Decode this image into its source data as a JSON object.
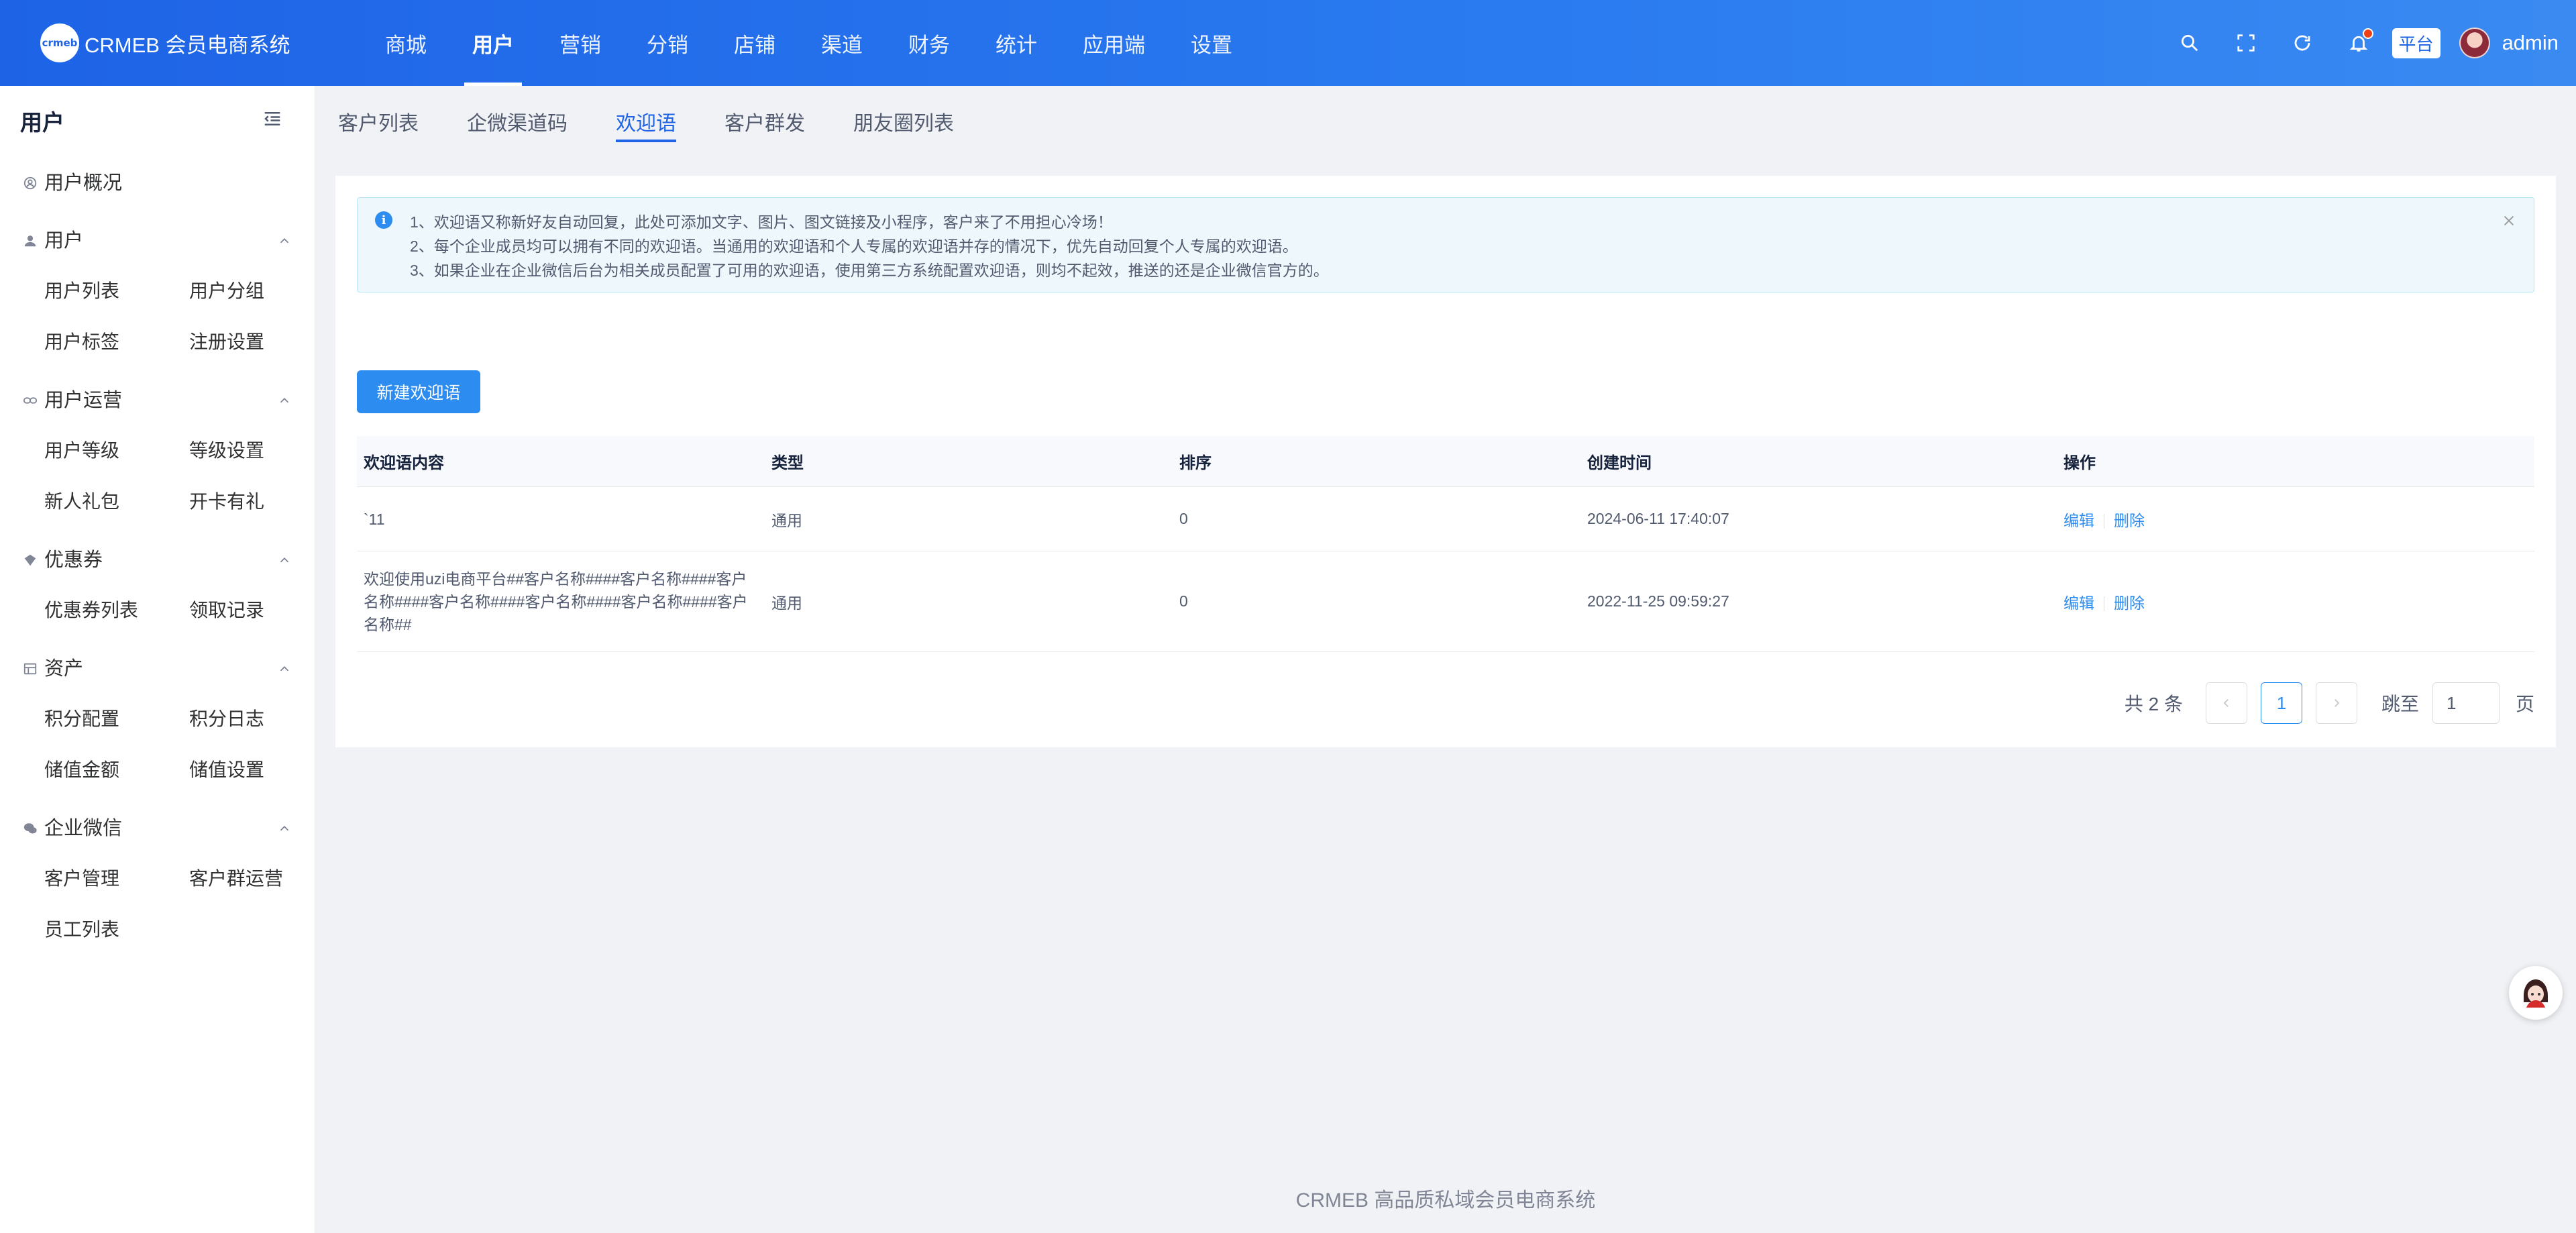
{
  "app": {
    "logo_mark": "crmeb",
    "name": "CRMEB 会员电商系统"
  },
  "topnav": [
    {
      "label": "商城"
    },
    {
      "label": "用户"
    },
    {
      "label": "营销"
    },
    {
      "label": "分销"
    },
    {
      "label": "店铺"
    },
    {
      "label": "渠道"
    },
    {
      "label": "财务"
    },
    {
      "label": "统计"
    },
    {
      "label": "应用端"
    },
    {
      "label": "设置"
    }
  ],
  "topnav_active": "用户",
  "header_right": {
    "platform_tag": "平台",
    "username": "admin",
    "icons": [
      "search-icon",
      "fullscreen-icon",
      "refresh-icon",
      "bell-icon"
    ]
  },
  "sidebar": {
    "title": "用户",
    "overview": "用户概况",
    "groups": [
      {
        "label": "用户",
        "icon": "user-icon",
        "items": [
          "用户列表",
          "用户分组",
          "用户标签",
          "注册设置"
        ]
      },
      {
        "label": "用户运营",
        "icon": "link-icon",
        "items": [
          "用户等级",
          "等级设置",
          "新人礼包",
          "开卡有礼"
        ]
      },
      {
        "label": "优惠券",
        "icon": "coupon-icon",
        "items": [
          "优惠券列表",
          "领取记录"
        ]
      },
      {
        "label": "资产",
        "icon": "asset-icon",
        "items": [
          "积分配置",
          "积分日志",
          "储值金额",
          "储值设置"
        ]
      },
      {
        "label": "企业微信",
        "icon": "wechat-icon",
        "items": [
          "客户管理",
          "客户群运营",
          "员工列表"
        ]
      }
    ]
  },
  "tabs": [
    {
      "label": "客户列表"
    },
    {
      "label": "企微渠道码"
    },
    {
      "label": "欢迎语"
    },
    {
      "label": "客户群发"
    },
    {
      "label": "朋友圈列表"
    }
  ],
  "active_tab": "欢迎语",
  "notice": {
    "lines": [
      "1、欢迎语又称新好友自动回复，此处可添加文字、图片、图文链接及小程序，客户来了不用担心冷场！",
      "2、每个企业成员均可以拥有不同的欢迎语。当通用的欢迎语和个人专属的欢迎语并存的情况下，优先自动回复个人专属的欢迎语。",
      "3、如果企业在企业微信后台为相关成员配置了可用的欢迎语，使用第三方系统配置欢迎语，则均不起效，推送的还是企业微信官方的。"
    ]
  },
  "toolbar": {
    "new_button": "新建欢迎语"
  },
  "table": {
    "columns": [
      "欢迎语内容",
      "类型",
      "排序",
      "创建时间",
      "操作"
    ],
    "rows": [
      {
        "content": "`11",
        "type": "通用",
        "sort": "0",
        "created": "2024-06-11 17:40:07",
        "edit": "编辑",
        "delete": "删除"
      },
      {
        "content": "欢迎使用uzi电商平台##客户名称####客户名称####客户名称####客户名称####客户名称####客户名称####客户名称##",
        "type": "通用",
        "sort": "0",
        "created": "2022-11-25 09:59:27",
        "edit": "编辑",
        "delete": "删除"
      }
    ]
  },
  "pagination": {
    "total": "共 2 条",
    "current": "1",
    "jump_label": "跳至",
    "jump_value": "1",
    "page_unit": "页"
  },
  "footer": "CRMEB 高品质私域会员电商系统",
  "colors": {
    "header_gradient_start": "#1e63e6",
    "header_gradient_end": "#3a8af2",
    "primary": "#2d8cf0",
    "alert_bg": "#eef8fc",
    "page_bg": "#f0f2f5"
  }
}
